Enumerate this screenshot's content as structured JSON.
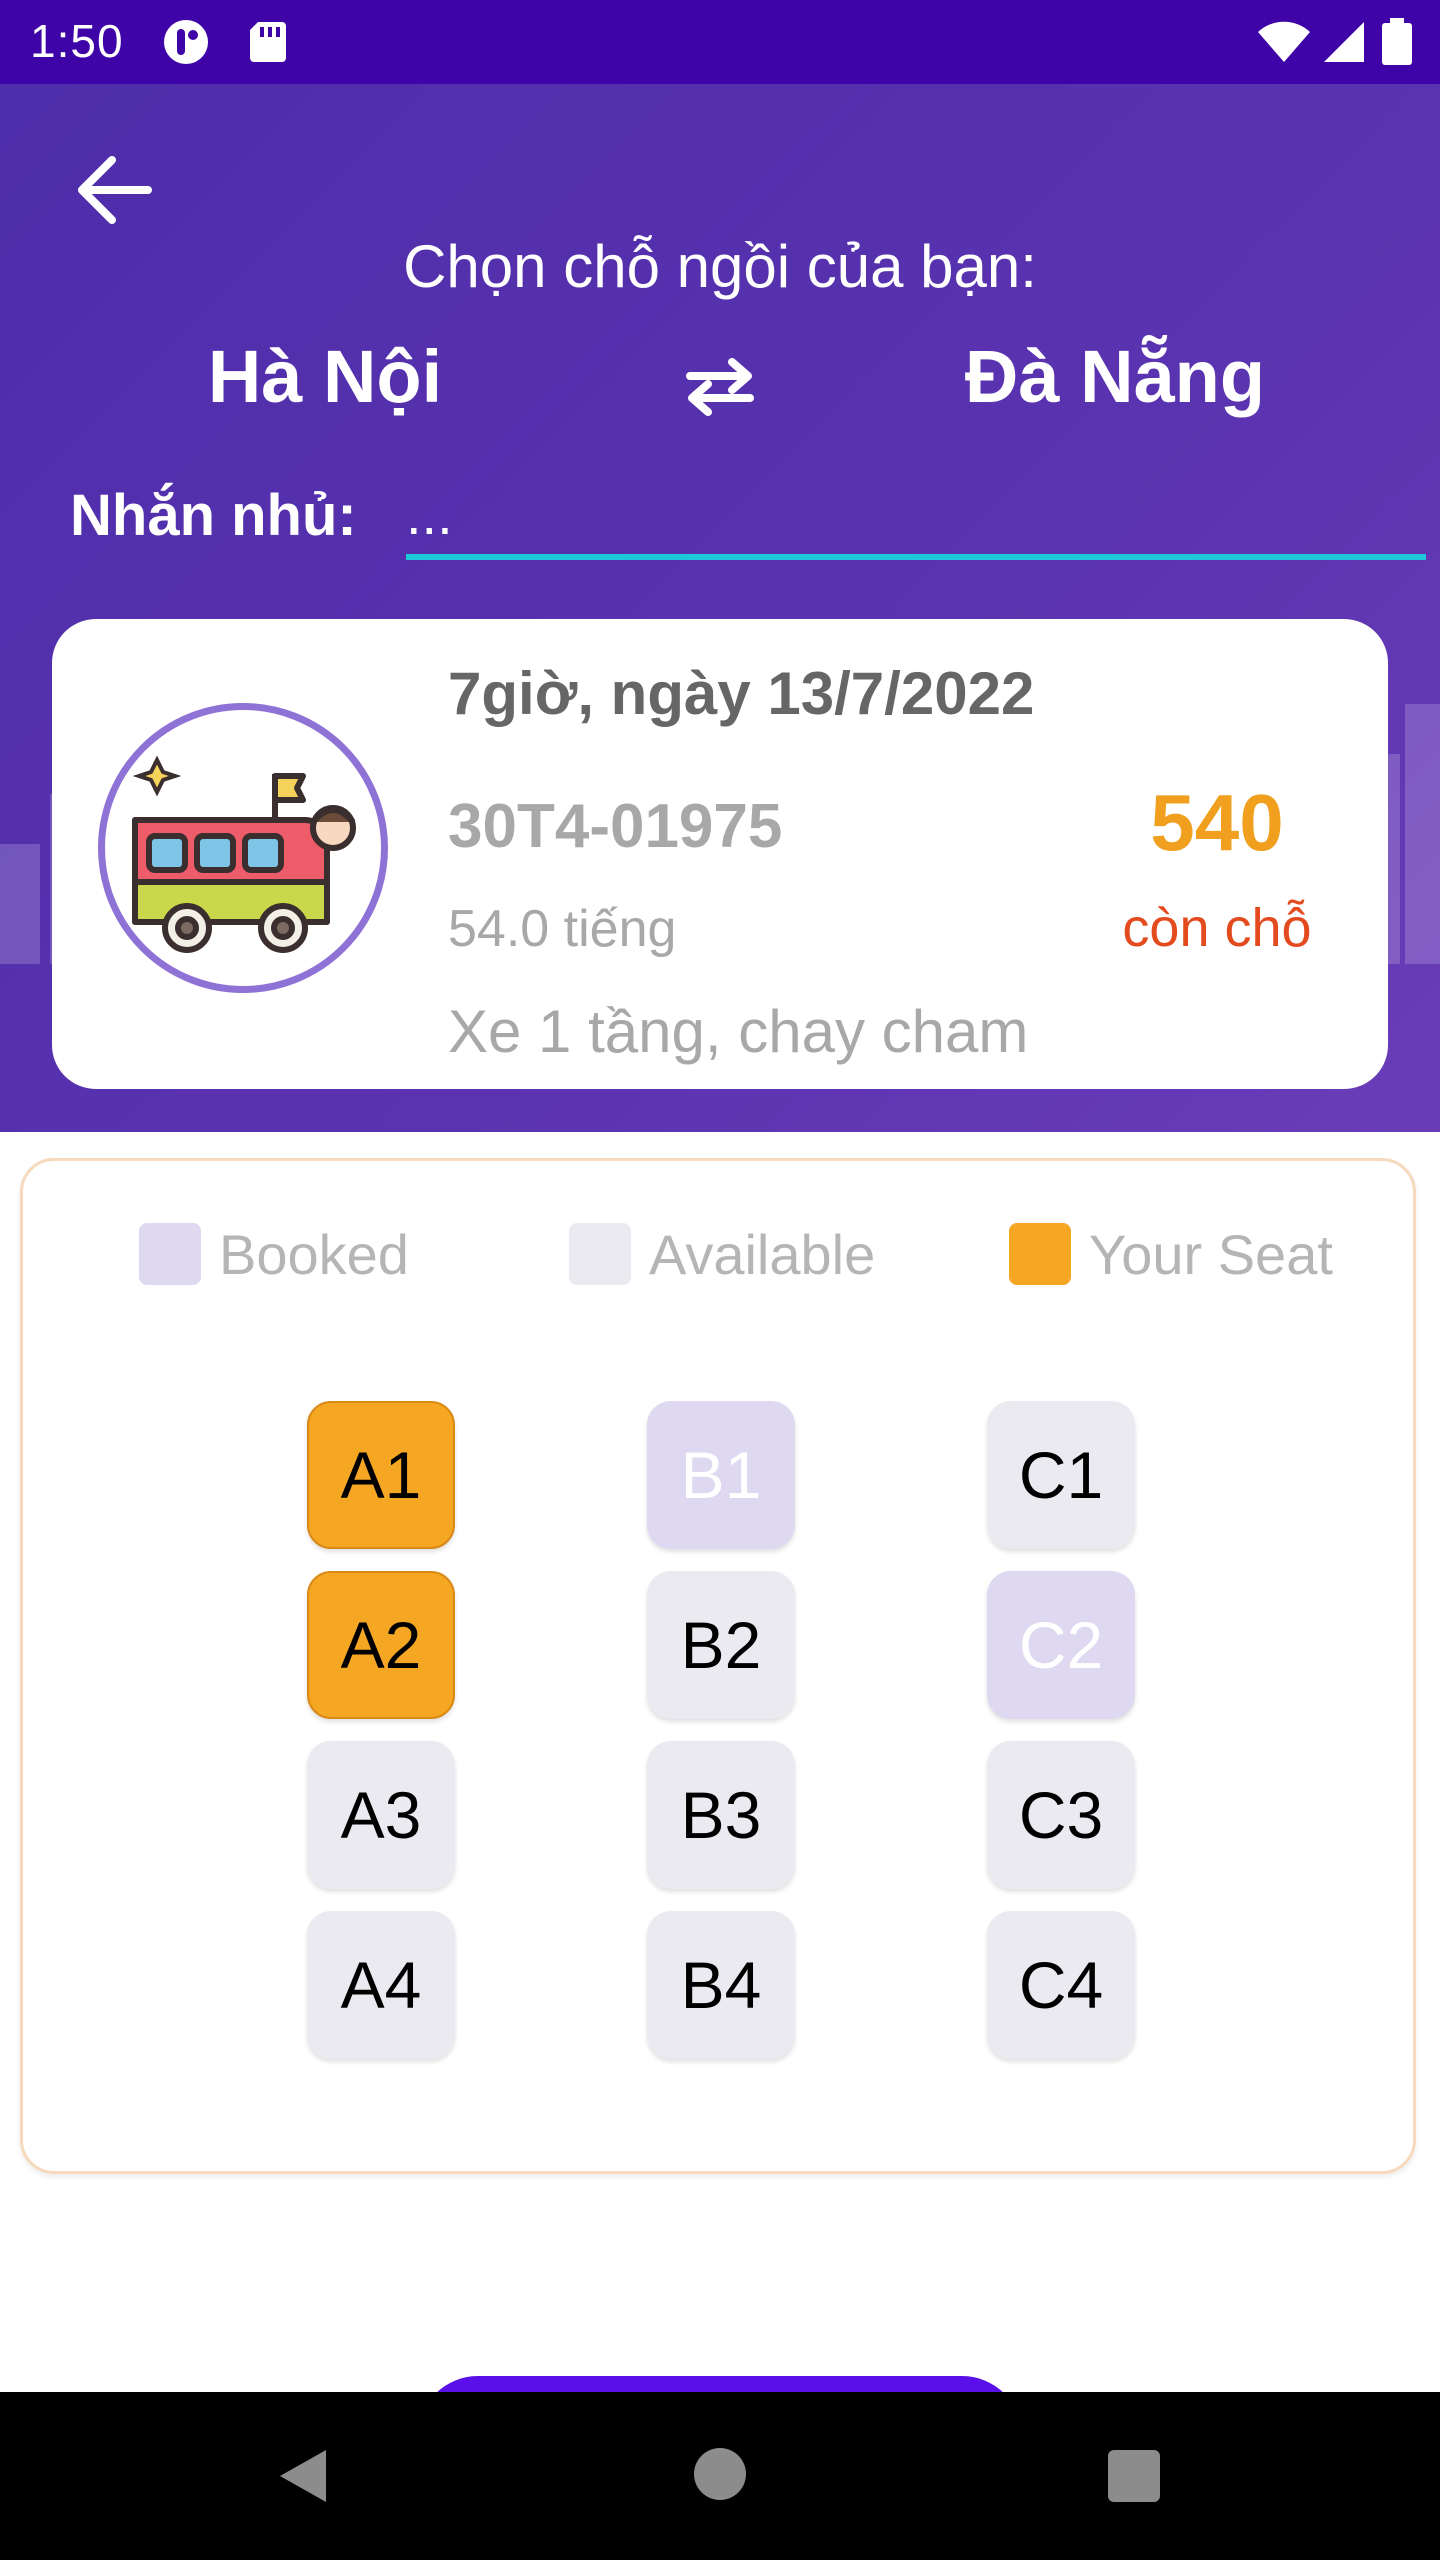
{
  "status_bar": {
    "time": "1:50"
  },
  "header": {
    "title": "Chọn chỗ ngồi của bạn:",
    "from": "Hà Nội",
    "to": "Đà Nẵng",
    "note_label": "Nhắn nhủ:",
    "note_placeholder": "..."
  },
  "trip": {
    "datetime": "7giờ, ngày 13/7/2022",
    "plate": "30T4-01975",
    "duration": "54.0 tiếng",
    "description": "Xe 1 tầng, chay cham",
    "seats_left": "540",
    "seats_left_label": "còn chỗ"
  },
  "legend": {
    "booked": "Booked",
    "available": "Available",
    "your_seat": "Your Seat"
  },
  "seats": [
    {
      "label": "A1",
      "status": "yours"
    },
    {
      "label": "B1",
      "status": "booked"
    },
    {
      "label": "C1",
      "status": "available"
    },
    {
      "label": "A2",
      "status": "yours"
    },
    {
      "label": "B2",
      "status": "available"
    },
    {
      "label": "C2",
      "status": "booked"
    },
    {
      "label": "A3",
      "status": "available"
    },
    {
      "label": "B3",
      "status": "available"
    },
    {
      "label": "C3",
      "status": "available"
    },
    {
      "label": "A4",
      "status": "available"
    },
    {
      "label": "B4",
      "status": "available"
    },
    {
      "label": "C4",
      "status": "available"
    }
  ],
  "colors": {
    "header": "#5A33B0",
    "status_bar": "#3E04A8",
    "your_seat": "#F5A623",
    "booked": "#DED8F0",
    "available": "#EBEAF0",
    "accent_underline": "#1FC8D8",
    "seats_count": "#F0A01E",
    "seats_label": "#E34A1E"
  }
}
